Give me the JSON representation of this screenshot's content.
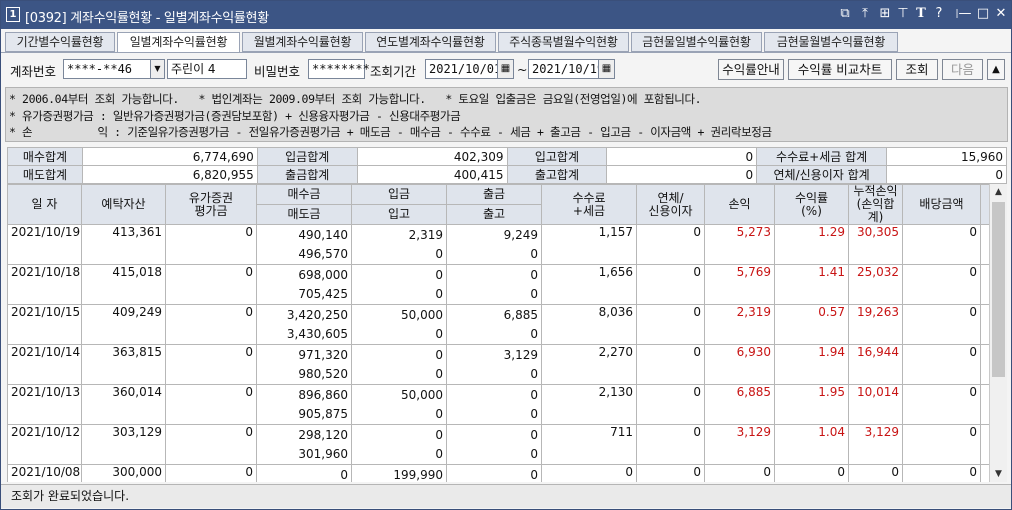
{
  "window": {
    "number": "1",
    "title": "[0392] 계좌수익률현황 - 일별계좌수익률현황"
  },
  "tabs": [
    "기간별수익률현황",
    "일별계좌수익률현황",
    "월별계좌수익률현황",
    "연도별계좌수익률현황",
    "주식종목별월수익현황",
    "금현물일별수익률현황",
    "금현물월별수익률현황"
  ],
  "query": {
    "account_label": "계좌번호",
    "account_value": "****-**46",
    "holder_name": "주린이 4",
    "password_label": "비밀번호",
    "password_value": "********",
    "period_label": "조회기간",
    "date_from": "2021/10/01",
    "date_sep": "~",
    "date_to": "2021/10/19",
    "btn_guide": "수익률안내",
    "btn_compare": "수익률 비교차트",
    "btn_search": "조회",
    "btn_next": "다음"
  },
  "notes": [
    "* 2006.04부터 조회 가능합니다.   * 법인계좌는 2009.09부터 조회 가능합니다.   * 토요일 입출금은 금요일(전영업일)에 포함됩니다.",
    "* 유가증권평가금 : 일반유가증권평가금(증권담보포함) + 신용융자평가금 - 신용대주평가금",
    "* 손          익 : 기준일유가증권평가금 - 전일유가증권평가금 + 매도금 - 매수금 - 수수료 - 세금 + 출고금 - 입고금 - 이자금액 + 권리락보정금"
  ],
  "summary": {
    "row1": [
      {
        "label": "매수합계",
        "value": "6,774,690"
      },
      {
        "label": "입금합계",
        "value": "402,309"
      },
      {
        "label": "입고합계",
        "value": "0"
      },
      {
        "label": "수수료+세금 합계",
        "value": "15,960"
      }
    ],
    "row2": [
      {
        "label": "매도합계",
        "value": "6,820,955"
      },
      {
        "label": "출금합계",
        "value": "400,415"
      },
      {
        "label": "출고합계",
        "value": "0"
      },
      {
        "label": "연체/신용이자 합계",
        "value": "0"
      }
    ]
  },
  "headers": {
    "date": "일  자",
    "deposit": "예탁자산",
    "securities": "유가증권\n평가금",
    "buy": "매수금",
    "sell": "매도금",
    "in_cash": "입금",
    "in_stock": "입고",
    "out_cash": "출금",
    "out_stock": "출고",
    "fee": "수수료\n+세금",
    "interest": "연체/\n신용이자",
    "pnl": "손익",
    "rate": "수익률\n(%)",
    "cum": "누적손익\n(손익합계)",
    "dividend": "배당금액"
  },
  "rows": [
    {
      "date": "2021/10/19",
      "deposit": "413,361",
      "securities": "0",
      "buy": "490,140",
      "sell": "496,570",
      "in_cash": "2,319",
      "in_stock": "0",
      "out_cash": "9,249",
      "out_stock": "0",
      "fee": "1,157",
      "interest": "0",
      "pnl": "5,273",
      "rate": "1.29",
      "cum": "30,305",
      "dividend": "0"
    },
    {
      "date": "2021/10/18",
      "deposit": "415,018",
      "securities": "0",
      "buy": "698,000",
      "sell": "705,425",
      "in_cash": "0",
      "in_stock": "0",
      "out_cash": "0",
      "out_stock": "0",
      "fee": "1,656",
      "interest": "0",
      "pnl": "5,769",
      "rate": "1.41",
      "cum": "25,032",
      "dividend": "0"
    },
    {
      "date": "2021/10/15",
      "deposit": "409,249",
      "securities": "0",
      "buy": "3,420,250",
      "sell": "3,430,605",
      "in_cash": "50,000",
      "in_stock": "0",
      "out_cash": "6,885",
      "out_stock": "0",
      "fee": "8,036",
      "interest": "0",
      "pnl": "2,319",
      "rate": "0.57",
      "cum": "19,263",
      "dividend": "0"
    },
    {
      "date": "2021/10/14",
      "deposit": "363,815",
      "securities": "0",
      "buy": "971,320",
      "sell": "980,520",
      "in_cash": "0",
      "in_stock": "0",
      "out_cash": "3,129",
      "out_stock": "0",
      "fee": "2,270",
      "interest": "0",
      "pnl": "6,930",
      "rate": "1.94",
      "cum": "16,944",
      "dividend": "0"
    },
    {
      "date": "2021/10/13",
      "deposit": "360,014",
      "securities": "0",
      "buy": "896,860",
      "sell": "905,875",
      "in_cash": "50,000",
      "in_stock": "0",
      "out_cash": "0",
      "out_stock": "0",
      "fee": "2,130",
      "interest": "0",
      "pnl": "6,885",
      "rate": "1.95",
      "cum": "10,014",
      "dividend": "0"
    },
    {
      "date": "2021/10/12",
      "deposit": "303,129",
      "securities": "0",
      "buy": "298,120",
      "sell": "301,960",
      "in_cash": "0",
      "in_stock": "0",
      "out_cash": "0",
      "out_stock": "0",
      "fee": "711",
      "interest": "0",
      "pnl": "3,129",
      "rate": "1.04",
      "cum": "3,129",
      "dividend": "0"
    },
    {
      "date": "2021/10/08",
      "deposit": "300,000",
      "securities": "0",
      "buy": "0",
      "sell": "0",
      "in_cash": "199,990",
      "in_stock": "0",
      "out_cash": "0",
      "out_stock": "0",
      "fee": "0",
      "interest": "0",
      "pnl": "0",
      "rate": "0",
      "cum": "0",
      "dividend": "0"
    }
  ],
  "status": "조회가 완료되었습니다.",
  "colors": {
    "titlebar": "#3c5585",
    "header": "#dfe4ec",
    "profit": "#c81414"
  }
}
